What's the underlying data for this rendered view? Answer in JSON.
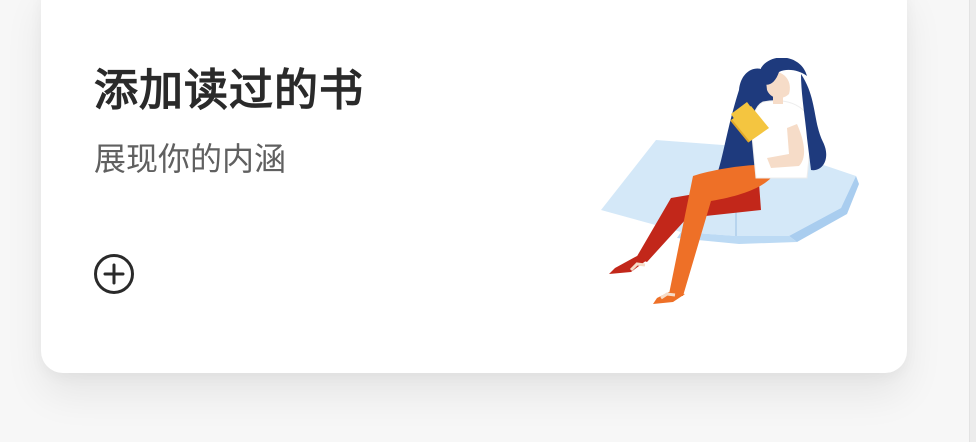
{
  "card": {
    "title": "添加读过的书",
    "subtitle": "展现你的内涵",
    "add_icon": "plus-circle-icon",
    "illustration": "woman-reading-book"
  },
  "colors": {
    "card_background": "#ffffff",
    "title": "#2a2a2a",
    "subtitle": "#606060",
    "hair": "#1e3a7d",
    "trousers": "#ee7027",
    "book_page": "#d4e8f8",
    "held_book": "#f4c540"
  }
}
